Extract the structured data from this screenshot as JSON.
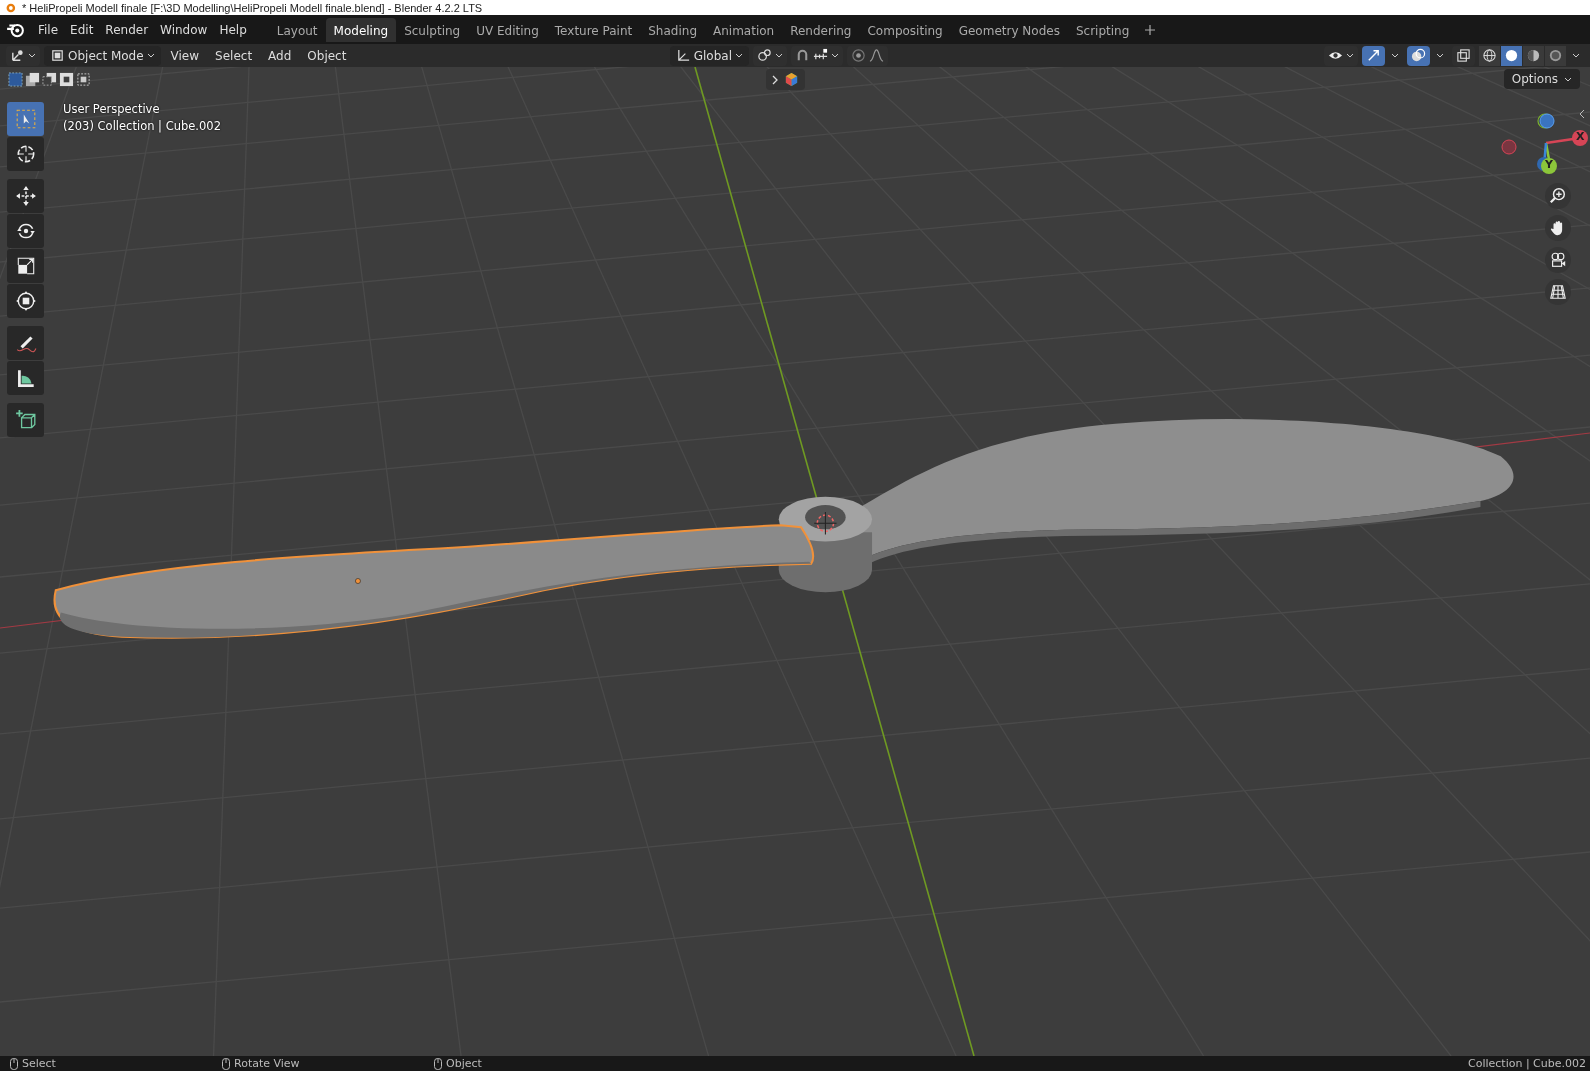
{
  "title_bar": {
    "title": "* HeliPropeli Modell finale [F:\\3D Modelling\\HeliPropeli Modell finale.blend] - Blender 4.2.2 LTS"
  },
  "menu": [
    "File",
    "Edit",
    "Render",
    "Window",
    "Help"
  ],
  "workspaces": [
    {
      "label": "Layout",
      "selected": false
    },
    {
      "label": "Modeling",
      "selected": true
    },
    {
      "label": "Sculpting",
      "selected": false
    },
    {
      "label": "UV Editing",
      "selected": false
    },
    {
      "label": "Texture Paint",
      "selected": false
    },
    {
      "label": "Shading",
      "selected": false
    },
    {
      "label": "Animation",
      "selected": false
    },
    {
      "label": "Rendering",
      "selected": false
    },
    {
      "label": "Compositing",
      "selected": false
    },
    {
      "label": "Geometry Nodes",
      "selected": false
    },
    {
      "label": "Scripting",
      "selected": false
    }
  ],
  "header": {
    "mode": "Object Mode",
    "menus": [
      "View",
      "Select",
      "Add",
      "Object"
    ],
    "orientation": "Global",
    "shading": [
      {
        "kind": "wireframe",
        "selected": false
      },
      {
        "kind": "solid",
        "selected": true
      },
      {
        "kind": "material",
        "selected": false
      },
      {
        "kind": "rendered",
        "selected": false
      }
    ]
  },
  "viewport": {
    "view_name": "User Perspective",
    "info": "(203) Collection | Cube.002",
    "options": "Options",
    "tool_groups": [
      [
        {
          "kind": "select",
          "selected": true
        },
        {
          "kind": "cursor",
          "selected": false
        }
      ],
      [
        {
          "kind": "move",
          "selected": false
        },
        {
          "kind": "rotate",
          "selected": false
        },
        {
          "kind": "scale",
          "selected": false
        },
        {
          "kind": "transform",
          "selected": false
        }
      ],
      [
        {
          "kind": "annotate",
          "selected": false
        },
        {
          "kind": "measure",
          "selected": false
        }
      ],
      [
        {
          "kind": "add-cube",
          "selected": false
        }
      ]
    ],
    "gizmo_axes": [
      "X",
      "Y"
    ]
  },
  "status_bar": {
    "hints": [
      "Select",
      "Rotate View",
      "Object"
    ],
    "stats": "Collection | Cube.002"
  }
}
